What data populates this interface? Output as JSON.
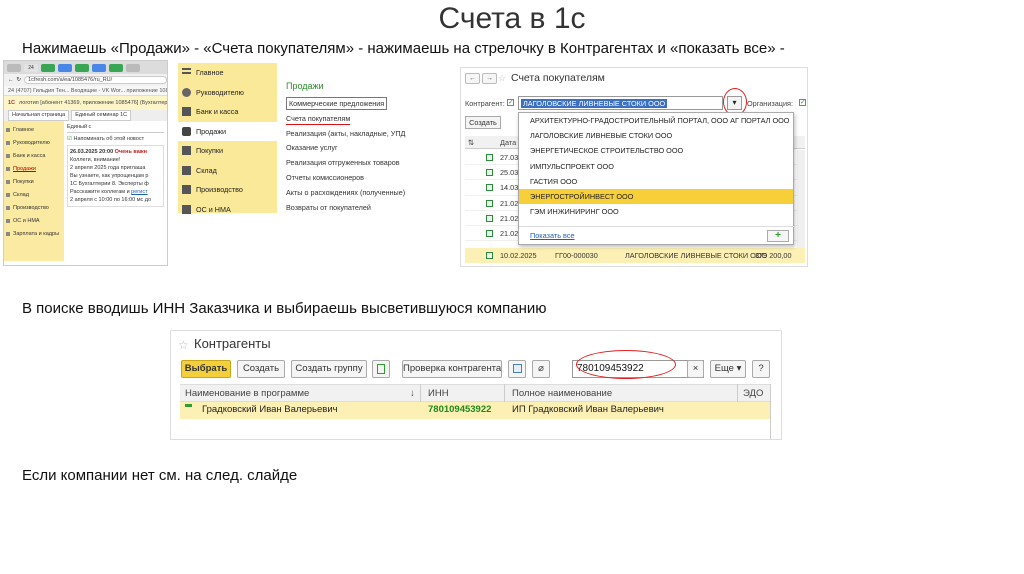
{
  "slide": {
    "title": "Счета в 1с",
    "step1": "Нажимаешь «Продажи» - «Счета покупателям» - нажимаешь на стрелочку в Контрагентах и «показать все» -",
    "step2": "В поиске вводишь ИНН Заказчика и выбираешь высветившуюся компанию",
    "step3": "Если компании нет см. на след. слайде"
  },
  "browser": {
    "tab_count": "24",
    "url": "1cfresh.com/a/ea/1085476/ru_RU/",
    "bookmark_bar": "24 (4707) Гильдия Тен...  Входящие - VK Wor...  приложение 1085476",
    "app_line": "логотип [абонент 41369, приложение 1085476] (Бухгалтерия",
    "tabs": [
      "Начальная страница",
      "Единый семинар 1С"
    ],
    "sidebar": [
      "Главное",
      "Руководителю",
      "Банк и касса",
      "Продажи",
      "Покупки",
      "Склад",
      "Производство",
      "ОС и НМА",
      "Зарплата и кадры"
    ],
    "header_text": "Единый с",
    "checkbox_text": "Напоминать об этой новост",
    "news_date": "26.03.2025 20:00",
    "news_title": "Очень важн",
    "news_lines": [
      "Коллеги, внимание!",
      "2 апреля 2025 года приглаша",
      "Вы узнаете, как упрощенцам р",
      "1С Бухгалтерии 8. Эксперты ф",
      "Расскажите коллегам и",
      "2 апреля с 10:00 по 16:00 мс"
    ],
    "news_link": "регист",
    "news_cont": "до"
  },
  "sections": {
    "sidebar": [
      {
        "label": "Главное"
      },
      {
        "label": "Руководителю"
      },
      {
        "label": "Банк и касса"
      },
      {
        "label": "Продажи"
      },
      {
        "label": "Покупки"
      },
      {
        "label": "Склад"
      },
      {
        "label": "Производство"
      },
      {
        "label": "ОС и НМА"
      }
    ],
    "panel_title": "Продажи",
    "links": [
      "Коммерческие предложения",
      "Счета покупателям",
      "Реализация (акты, накладные, УПД",
      "Оказание услуг",
      "Реализация отгруженных товаров",
      "Отчеты комиссионеров",
      "Акты о расхождениях (полученные)",
      "Возвраты от покупателей"
    ]
  },
  "invoices": {
    "nav_back": "←",
    "nav_fwd": "→",
    "title": "Счета покупателям",
    "counterparty_label": "Контрагент:",
    "counterparty_value": "ЛАГОЛОВСКИЕ ЛИВНЕВЫЕ СТОКИ ООО",
    "dropdown_arrow": "▾",
    "org_label": "Организация:",
    "create_label": "Создать",
    "column_date": "Дата",
    "dates": [
      "27.03",
      "25.03",
      "14.03",
      "21.02",
      "21.02",
      "21.02",
      "10.02"
    ],
    "dropdown": [
      "АРХИТЕКТУРНО-ГРАДОСТРОИТЕЛЬНЫЙ ПОРТАЛ, ООО АГ ПОРТАЛ ООО",
      "ЛАГОЛОВСКИЕ ЛИВНЕВЫЕ СТОКИ ООО",
      "ЭНЕРГЕТИЧЕСКОЕ СТРОИТЕЛЬСТВО ООО",
      "ИМПУЛЬСПРОЕКТ ООО",
      "ГАСТИЯ ООО",
      "ЭНЕРГОСТРОЙИНВЕСТ ООО",
      "ГЭМ ИНЖИНИРИНГ ООО"
    ],
    "show_all": "Показать все",
    "plus": "+",
    "last_row": {
      "date": "10.02.2025",
      "number": "ГГ00-000030",
      "name": "ЛАГОЛОВСКИЕ ЛИВНЕВЫЕ СТОКИ ООО",
      "amount": "379 200,00"
    }
  },
  "contractors": {
    "star": "☆",
    "title": "Контрагенты",
    "buttons": {
      "select": "Выбрать",
      "create": "Создать",
      "create_group": "Создать группу",
      "check": "Проверка контрагента",
      "more": "Еще ▾",
      "help": "?"
    },
    "search_value": "780109453922",
    "clear": "×",
    "columns": {
      "name": "Наименование в программе",
      "inn": "ИНН",
      "full": "Полное наименование",
      "edo": "ЭДО"
    },
    "row": {
      "name": "Градковский Иван Валерьевич",
      "inn": "780109453922",
      "full": "ИП Градковский Иван Валерьевич"
    }
  }
}
